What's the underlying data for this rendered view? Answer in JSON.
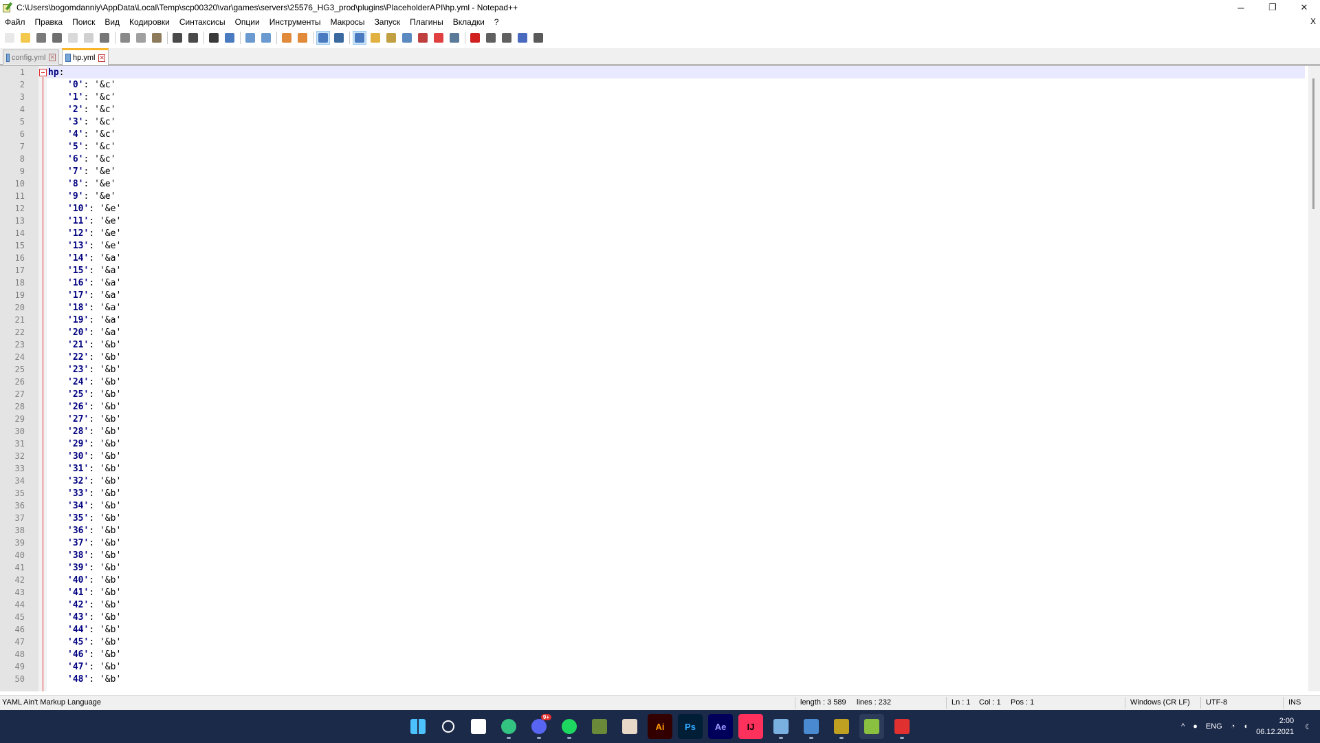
{
  "window": {
    "title": "C:\\Users\\bogomdanniy\\AppData\\Local\\Temp\\scp00320\\var\\games\\servers\\25576_HG3_prod\\plugins\\PlaceholderAPI\\hp.yml - Notepad++",
    "minimize": "─",
    "maximize": "❐",
    "close": "✕"
  },
  "menu": {
    "items": [
      "Файл",
      "Правка",
      "Поиск",
      "Вид",
      "Кодировки",
      "Синтаксисы",
      "Опции",
      "Инструменты",
      "Макросы",
      "Запуск",
      "Плагины",
      "Вкладки",
      "?"
    ],
    "close_label": "X"
  },
  "toolbar": {
    "buttons": [
      {
        "icon": "new-file-icon",
        "color": "#e8e8e8"
      },
      {
        "icon": "open-file-icon",
        "color": "#f2c94c"
      },
      {
        "icon": "save-icon",
        "color": "#7a7a7a"
      },
      {
        "icon": "save-all-icon",
        "color": "#6f6f6f"
      },
      {
        "icon": "close-file-icon",
        "color": "#d9d9d9"
      },
      {
        "icon": "close-all-icon",
        "color": "#d0d0d0"
      },
      {
        "icon": "print-icon",
        "color": "#777777"
      },
      {
        "sep": true
      },
      {
        "icon": "cut-icon",
        "color": "#8a8a8a"
      },
      {
        "icon": "copy-icon",
        "color": "#a0a0a0"
      },
      {
        "icon": "paste-icon",
        "color": "#8c7a5a"
      },
      {
        "sep": true
      },
      {
        "icon": "undo-icon",
        "color": "#4a4a4a"
      },
      {
        "icon": "redo-icon",
        "color": "#4a4a4a"
      },
      {
        "sep": true
      },
      {
        "icon": "find-icon",
        "color": "#3a3a3a"
      },
      {
        "icon": "replace-icon",
        "color": "#4a7ac0"
      },
      {
        "sep": true
      },
      {
        "icon": "zoom-in-icon",
        "color": "#6a9ad0"
      },
      {
        "icon": "zoom-out-icon",
        "color": "#6a9ad0"
      },
      {
        "sep": true
      },
      {
        "icon": "sync-vertical-icon",
        "color": "#e08a3a"
      },
      {
        "icon": "sync-horizontal-icon",
        "color": "#e08a3a"
      },
      {
        "sep": true
      },
      {
        "icon": "word-wrap-icon",
        "color": "#4a7ac0",
        "active": true
      },
      {
        "icon": "show-all-chars-icon",
        "color": "#3a6aa0"
      },
      {
        "sep": true
      },
      {
        "icon": "indent-guide-icon",
        "color": "#4a7ac0",
        "active": true
      },
      {
        "icon": "define-language-icon",
        "color": "#e0b040"
      },
      {
        "icon": "doc-map-icon",
        "color": "#c0a040"
      },
      {
        "icon": "function-list-icon",
        "color": "#5a8ac0"
      },
      {
        "icon": "folder-workspace-icon",
        "color": "#c04040"
      },
      {
        "icon": "monitoring-icon",
        "color": "#e04040"
      },
      {
        "icon": "eye-icon",
        "color": "#5a7a9a"
      },
      {
        "sep": true
      },
      {
        "icon": "record-macro-icon",
        "color": "#d02020"
      },
      {
        "icon": "stop-macro-icon",
        "color": "#606060"
      },
      {
        "icon": "play-macro-icon",
        "color": "#606060"
      },
      {
        "icon": "run-macro-multiple-icon",
        "color": "#4a6ac0"
      },
      {
        "icon": "save-macro-icon",
        "color": "#5a5a5a"
      }
    ]
  },
  "tabs": [
    {
      "label": "config.yml",
      "active": false
    },
    {
      "label": "hp.yml",
      "active": true
    }
  ],
  "editor": {
    "lines": [
      {
        "n": "1",
        "key": "hp",
        "val": ""
      },
      {
        "n": "2",
        "key": "'0'",
        "val": "'&c'"
      },
      {
        "n": "3",
        "key": "'1'",
        "val": "'&c'"
      },
      {
        "n": "4",
        "key": "'2'",
        "val": "'&c'"
      },
      {
        "n": "5",
        "key": "'3'",
        "val": "'&c'"
      },
      {
        "n": "6",
        "key": "'4'",
        "val": "'&c'"
      },
      {
        "n": "7",
        "key": "'5'",
        "val": "'&c'"
      },
      {
        "n": "8",
        "key": "'6'",
        "val": "'&c'"
      },
      {
        "n": "9",
        "key": "'7'",
        "val": "'&e'"
      },
      {
        "n": "10",
        "key": "'8'",
        "val": "'&e'"
      },
      {
        "n": "11",
        "key": "'9'",
        "val": "'&e'"
      },
      {
        "n": "12",
        "key": "'10'",
        "val": "'&e'"
      },
      {
        "n": "13",
        "key": "'11'",
        "val": "'&e'"
      },
      {
        "n": "14",
        "key": "'12'",
        "val": "'&e'"
      },
      {
        "n": "15",
        "key": "'13'",
        "val": "'&e'"
      },
      {
        "n": "16",
        "key": "'14'",
        "val": "'&a'"
      },
      {
        "n": "17",
        "key": "'15'",
        "val": "'&a'"
      },
      {
        "n": "18",
        "key": "'16'",
        "val": "'&a'"
      },
      {
        "n": "19",
        "key": "'17'",
        "val": "'&a'"
      },
      {
        "n": "20",
        "key": "'18'",
        "val": "'&a'"
      },
      {
        "n": "21",
        "key": "'19'",
        "val": "'&a'"
      },
      {
        "n": "22",
        "key": "'20'",
        "val": "'&a'"
      },
      {
        "n": "23",
        "key": "'21'",
        "val": "'&b'"
      },
      {
        "n": "24",
        "key": "'22'",
        "val": "'&b'"
      },
      {
        "n": "25",
        "key": "'23'",
        "val": "'&b'"
      },
      {
        "n": "26",
        "key": "'24'",
        "val": "'&b'"
      },
      {
        "n": "27",
        "key": "'25'",
        "val": "'&b'"
      },
      {
        "n": "28",
        "key": "'26'",
        "val": "'&b'"
      },
      {
        "n": "29",
        "key": "'27'",
        "val": "'&b'"
      },
      {
        "n": "30",
        "key": "'28'",
        "val": "'&b'"
      },
      {
        "n": "31",
        "key": "'29'",
        "val": "'&b'"
      },
      {
        "n": "32",
        "key": "'30'",
        "val": "'&b'"
      },
      {
        "n": "33",
        "key": "'31'",
        "val": "'&b'"
      },
      {
        "n": "34",
        "key": "'32'",
        "val": "'&b'"
      },
      {
        "n": "35",
        "key": "'33'",
        "val": "'&b'"
      },
      {
        "n": "36",
        "key": "'34'",
        "val": "'&b'"
      },
      {
        "n": "37",
        "key": "'35'",
        "val": "'&b'"
      },
      {
        "n": "38",
        "key": "'36'",
        "val": "'&b'"
      },
      {
        "n": "39",
        "key": "'37'",
        "val": "'&b'"
      },
      {
        "n": "40",
        "key": "'38'",
        "val": "'&b'"
      },
      {
        "n": "41",
        "key": "'39'",
        "val": "'&b'"
      },
      {
        "n": "42",
        "key": "'40'",
        "val": "'&b'"
      },
      {
        "n": "43",
        "key": "'41'",
        "val": "'&b'"
      },
      {
        "n": "44",
        "key": "'42'",
        "val": "'&b'"
      },
      {
        "n": "45",
        "key": "'43'",
        "val": "'&b'"
      },
      {
        "n": "46",
        "key": "'44'",
        "val": "'&b'"
      },
      {
        "n": "47",
        "key": "'45'",
        "val": "'&b'"
      },
      {
        "n": "48",
        "key": "'46'",
        "val": "'&b'"
      },
      {
        "n": "49",
        "key": "'47'",
        "val": "'&b'"
      },
      {
        "n": "50",
        "key": "'48'",
        "val": "'&b'"
      }
    ]
  },
  "status": {
    "language": "YAML Ain't Markup Language",
    "length": "length : 3 589",
    "lines": "lines : 232",
    "ln": "Ln : 1",
    "col": "Col : 1",
    "pos": "Pos : 1",
    "eol": "Windows (CR LF)",
    "encoding": "UTF-8",
    "mode": "INS"
  },
  "taskbar": {
    "apps": [
      {
        "name": "start-icon",
        "label": "",
        "bg": "#1c2a4a",
        "fg": "#4cc2ff"
      },
      {
        "name": "search-icon",
        "label": "",
        "bg": "#1c2a4a",
        "fg": "#ffffff"
      },
      {
        "name": "task-view-icon",
        "label": "",
        "bg": "#1c2a4a",
        "fg": "#ffffff"
      },
      {
        "name": "edge-icon",
        "label": "",
        "bg": "#1c2a4a",
        "fg": "#33c481",
        "running": true
      },
      {
        "name": "discord-icon",
        "label": "",
        "bg": "#1c2a4a",
        "fg": "#5865f2",
        "running": true,
        "badge": "9+"
      },
      {
        "name": "spotify-icon",
        "label": "",
        "bg": "#1c2a4a",
        "fg": "#1ed760",
        "running": true
      },
      {
        "name": "minecraft-icon",
        "label": "",
        "bg": "#1c2a4a",
        "fg": "#6a8a3a"
      },
      {
        "name": "anime-app-icon",
        "label": "",
        "bg": "#1c2a4a",
        "fg": "#e8d8c8"
      },
      {
        "name": "illustrator-icon",
        "label": "Ai",
        "bg": "#330000",
        "fg": "#ff9a00"
      },
      {
        "name": "photoshop-icon",
        "label": "Ps",
        "bg": "#001e36",
        "fg": "#31a8ff"
      },
      {
        "name": "after-effects-icon",
        "label": "Ae",
        "bg": "#00005b",
        "fg": "#9999ff"
      },
      {
        "name": "intellij-icon",
        "label": "IJ",
        "bg": "#fe315d",
        "fg": "#000000"
      },
      {
        "name": "winscp-icon",
        "label": "",
        "bg": "#1c2a4a",
        "fg": "#7ab0e0",
        "running": true
      },
      {
        "name": "explorer-network-icon",
        "label": "",
        "bg": "#1c2a4a",
        "fg": "#4a8ad0",
        "running": true
      },
      {
        "name": "game-icon",
        "label": "",
        "bg": "#1c2a4a",
        "fg": "#c0a020",
        "running": true
      },
      {
        "name": "notepad-plus-plus-icon",
        "label": "",
        "bg": "#2d3b5b",
        "fg": "#8ac040",
        "current": true
      },
      {
        "name": "app-red-icon",
        "label": "",
        "bg": "#1c2a4a",
        "fg": "#e03030",
        "running": true
      }
    ],
    "tray": {
      "chevron": "^",
      "language": "ENG",
      "time": "2:00",
      "date": "06.12.2021"
    }
  }
}
